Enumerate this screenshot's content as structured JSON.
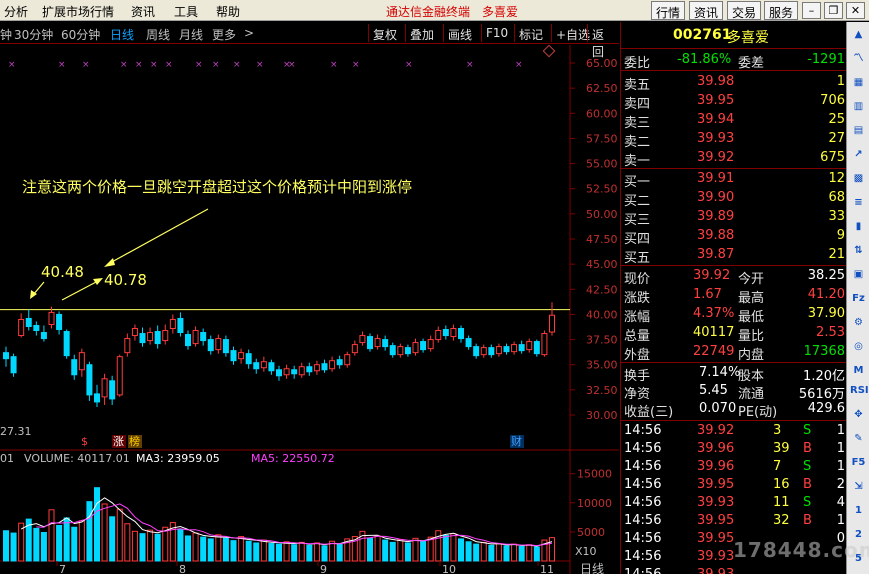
{
  "menu": {
    "items": [
      "分析",
      "扩展市场行情",
      "资讯",
      "工具",
      "帮助"
    ],
    "brand": "通达信金融终端",
    "stock_name_top": "多喜爱",
    "buttons": [
      "行情",
      "资讯",
      "交易",
      "服务"
    ]
  },
  "toolbar": {
    "periods": [
      "钟",
      "30分钟",
      "60分钟",
      "日线",
      "周线",
      "月线",
      "更多",
      ">"
    ],
    "active_period": "日线",
    "buttons": [
      "复权",
      "叠加",
      "画线",
      "F10",
      "标记",
      "+自选",
      "返回"
    ]
  },
  "chart": {
    "price_axis": [
      "65.00",
      "62.50",
      "60.00",
      "57.50",
      "55.00",
      "52.50",
      "50.00",
      "47.50",
      "45.00",
      "42.50",
      "40.00",
      "37.50",
      "35.00",
      "32.50",
      "30.00"
    ],
    "volume_axis": [
      "15000",
      "10000",
      "5000"
    ],
    "volume_unit": "X10",
    "annotation": "注意这两个价格一旦跳空开盘超过这个价格预计中阳到涨停",
    "label_a": "40.48",
    "label_b": "40.78",
    "low_label": "27.31",
    "markers": [
      "$",
      "涨",
      "榜",
      "财"
    ],
    "indicator": {
      "prefix": "01",
      "volume": "VOLUME: 40117.01",
      "ma3": "MA3: 23959.05",
      "ma5": "MA5: 22550.72"
    },
    "x_ticks": [
      "7",
      "8",
      "9",
      "10",
      "11"
    ],
    "period_label": "日线"
  },
  "chart_data": {
    "type": "candlestick",
    "ylim": [
      30,
      65
    ],
    "resistance": 40.48,
    "candles": [
      {
        "o": 36.2,
        "c": 35.6,
        "h": 36.8,
        "l": 34.8
      },
      {
        "o": 35.8,
        "c": 34.2,
        "h": 36.1,
        "l": 33.8
      },
      {
        "o": 37.9,
        "c": 39.5,
        "h": 40.1,
        "l": 37.7
      },
      {
        "o": 39.6,
        "c": 38.8,
        "h": 40.48,
        "l": 38.4
      },
      {
        "o": 38.9,
        "c": 38.4,
        "h": 39.3,
        "l": 37.9
      },
      {
        "o": 38.2,
        "c": 37.6,
        "h": 38.9,
        "l": 37.3
      },
      {
        "o": 39.0,
        "c": 40.2,
        "h": 40.78,
        "l": 38.6
      },
      {
        "o": 40.0,
        "c": 38.5,
        "h": 40.3,
        "l": 38.0
      },
      {
        "o": 38.3,
        "c": 35.9,
        "h": 38.5,
        "l": 35.6
      },
      {
        "o": 35.5,
        "c": 34.0,
        "h": 36.0,
        "l": 33.5
      },
      {
        "o": 34.5,
        "c": 36.2,
        "h": 36.6,
        "l": 33.8
      },
      {
        "o": 35.0,
        "c": 32.0,
        "h": 35.3,
        "l": 31.4
      },
      {
        "o": 32.1,
        "c": 31.3,
        "h": 33.0,
        "l": 30.8
      },
      {
        "o": 31.8,
        "c": 33.6,
        "h": 34.1,
        "l": 31.0
      },
      {
        "o": 33.4,
        "c": 31.6,
        "h": 33.9,
        "l": 31.0
      },
      {
        "o": 32.0,
        "c": 35.8,
        "h": 36.0,
        "l": 31.8
      },
      {
        "o": 36.2,
        "c": 37.6,
        "h": 38.1,
        "l": 35.8
      },
      {
        "o": 37.9,
        "c": 38.6,
        "h": 39.0,
        "l": 37.4
      },
      {
        "o": 38.1,
        "c": 37.2,
        "h": 38.7,
        "l": 36.8
      },
      {
        "o": 37.4,
        "c": 38.2,
        "h": 38.7,
        "l": 37.0
      },
      {
        "o": 38.3,
        "c": 37.1,
        "h": 38.9,
        "l": 36.6
      },
      {
        "o": 37.4,
        "c": 38.4,
        "h": 39.0,
        "l": 37.0
      },
      {
        "o": 38.6,
        "c": 39.5,
        "h": 40.0,
        "l": 38.1
      },
      {
        "o": 39.6,
        "c": 38.2,
        "h": 40.2,
        "l": 37.8
      },
      {
        "o": 38.0,
        "c": 36.9,
        "h": 38.4,
        "l": 36.5
      },
      {
        "o": 37.1,
        "c": 38.4,
        "h": 38.8,
        "l": 36.8
      },
      {
        "o": 38.2,
        "c": 37.4,
        "h": 38.6,
        "l": 36.9
      },
      {
        "o": 37.5,
        "c": 36.4,
        "h": 37.9,
        "l": 36.0
      },
      {
        "o": 36.5,
        "c": 37.6,
        "h": 38.0,
        "l": 36.1
      },
      {
        "o": 37.5,
        "c": 36.2,
        "h": 37.9,
        "l": 35.8
      },
      {
        "o": 36.4,
        "c": 35.4,
        "h": 36.8,
        "l": 35.0
      },
      {
        "o": 35.6,
        "c": 36.2,
        "h": 36.6,
        "l": 35.1
      },
      {
        "o": 36.1,
        "c": 35.1,
        "h": 36.5,
        "l": 34.6
      },
      {
        "o": 35.2,
        "c": 34.6,
        "h": 35.6,
        "l": 34.1
      },
      {
        "o": 34.7,
        "c": 35.3,
        "h": 35.8,
        "l": 34.3
      },
      {
        "o": 35.2,
        "c": 34.4,
        "h": 35.5,
        "l": 34.0
      },
      {
        "o": 34.5,
        "c": 33.9,
        "h": 34.9,
        "l": 33.4
      },
      {
        "o": 34.0,
        "c": 34.6,
        "h": 35.0,
        "l": 33.6
      },
      {
        "o": 34.5,
        "c": 34.1,
        "h": 34.9,
        "l": 33.6
      },
      {
        "o": 34.0,
        "c": 34.8,
        "h": 35.2,
        "l": 33.7
      },
      {
        "o": 34.8,
        "c": 34.3,
        "h": 35.2,
        "l": 33.9
      },
      {
        "o": 34.4,
        "c": 35.0,
        "h": 35.4,
        "l": 34.0
      },
      {
        "o": 35.1,
        "c": 34.5,
        "h": 35.5,
        "l": 34.2
      },
      {
        "o": 34.6,
        "c": 35.4,
        "h": 35.8,
        "l": 34.3
      },
      {
        "o": 35.5,
        "c": 35.0,
        "h": 35.9,
        "l": 34.6
      },
      {
        "o": 35.0,
        "c": 36.0,
        "h": 36.3,
        "l": 34.7
      },
      {
        "o": 36.2,
        "c": 37.0,
        "h": 37.4,
        "l": 35.9
      },
      {
        "o": 37.2,
        "c": 37.9,
        "h": 38.3,
        "l": 36.9
      },
      {
        "o": 37.8,
        "c": 36.6,
        "h": 38.1,
        "l": 36.3
      },
      {
        "o": 36.8,
        "c": 37.6,
        "h": 38.0,
        "l": 36.5
      },
      {
        "o": 37.5,
        "c": 36.8,
        "h": 37.9,
        "l": 36.4
      },
      {
        "o": 36.9,
        "c": 36.0,
        "h": 37.2,
        "l": 35.7
      },
      {
        "o": 36.0,
        "c": 36.8,
        "h": 37.1,
        "l": 35.7
      },
      {
        "o": 36.7,
        "c": 36.1,
        "h": 37.0,
        "l": 35.8
      },
      {
        "o": 36.2,
        "c": 37.2,
        "h": 37.6,
        "l": 35.9
      },
      {
        "o": 37.3,
        "c": 36.5,
        "h": 37.6,
        "l": 36.2
      },
      {
        "o": 36.6,
        "c": 37.5,
        "h": 37.9,
        "l": 36.3
      },
      {
        "o": 37.5,
        "c": 38.4,
        "h": 38.8,
        "l": 37.2
      },
      {
        "o": 38.5,
        "c": 37.9,
        "h": 38.9,
        "l": 37.5
      },
      {
        "o": 37.8,
        "c": 38.6,
        "h": 39.0,
        "l": 37.4
      },
      {
        "o": 38.6,
        "c": 37.6,
        "h": 38.9,
        "l": 37.2
      },
      {
        "o": 37.6,
        "c": 36.8,
        "h": 37.9,
        "l": 36.5
      },
      {
        "o": 36.8,
        "c": 35.9,
        "h": 37.1,
        "l": 35.6
      },
      {
        "o": 36.0,
        "c": 36.7,
        "h": 37.0,
        "l": 35.7
      },
      {
        "o": 36.7,
        "c": 36.0,
        "h": 37.0,
        "l": 35.7
      },
      {
        "o": 36.1,
        "c": 36.8,
        "h": 37.1,
        "l": 35.8
      },
      {
        "o": 36.8,
        "c": 36.3,
        "h": 37.1,
        "l": 36.0
      },
      {
        "o": 36.3,
        "c": 37.0,
        "h": 37.3,
        "l": 36.0
      },
      {
        "o": 37.0,
        "c": 36.4,
        "h": 37.4,
        "l": 36.1
      },
      {
        "o": 36.5,
        "c": 37.3,
        "h": 37.6,
        "l": 36.2
      },
      {
        "o": 37.3,
        "c": 36.1,
        "h": 37.5,
        "l": 35.8
      },
      {
        "o": 36.0,
        "c": 38.1,
        "h": 38.4,
        "l": 35.8
      },
      {
        "o": 38.25,
        "c": 39.92,
        "h": 41.2,
        "l": 37.9
      }
    ],
    "volume": [
      5200,
      4800,
      6500,
      7200,
      5600,
      4900,
      8800,
      6100,
      7400,
      5800,
      6900,
      10200,
      12600,
      9800,
      7600,
      8900,
      6400,
      5100,
      4700,
      5300,
      4600,
      5800,
      6600,
      5400,
      4300,
      4800,
      4100,
      3800,
      4500,
      3900,
      3500,
      4200,
      3400,
      3100,
      3600,
      3000,
      2900,
      3300,
      2800,
      3200,
      2700,
      3100,
      2600,
      3400,
      2900,
      3800,
      4200,
      5100,
      3900,
      4300,
      3600,
      3200,
      3700,
      3100,
      3900,
      3400,
      4100,
      5200,
      4400,
      4700,
      3800,
      3300,
      2900,
      3200,
      2700,
      3000,
      2600,
      2900,
      2500,
      2800,
      2400,
      3600,
      4012
    ]
  },
  "quote": {
    "code": "002761",
    "name": "多喜爱",
    "weibi_label": "委比",
    "weibi_value": "-81.86%",
    "weicha_label": "委差",
    "weicha_value": "-1291",
    "asks": [
      {
        "label": "卖五",
        "price": "39.98",
        "vol": "1"
      },
      {
        "label": "卖四",
        "price": "39.95",
        "vol": "706"
      },
      {
        "label": "卖三",
        "price": "39.94",
        "vol": "25"
      },
      {
        "label": "卖二",
        "price": "39.93",
        "vol": "27"
      },
      {
        "label": "卖一",
        "price": "39.92",
        "vol": "675"
      }
    ],
    "bids": [
      {
        "label": "买一",
        "price": "39.91",
        "vol": "12"
      },
      {
        "label": "买二",
        "price": "39.90",
        "vol": "68"
      },
      {
        "label": "买三",
        "price": "39.89",
        "vol": "33"
      },
      {
        "label": "买四",
        "price": "39.88",
        "vol": "9"
      },
      {
        "label": "买五",
        "price": "39.87",
        "vol": "21"
      }
    ],
    "stats": [
      {
        "l1": "现价",
        "v1": "39.92",
        "c1": "red",
        "l2": "今开",
        "v2": "38.25",
        "c2": "wht"
      },
      {
        "l1": "涨跌",
        "v1": "1.67",
        "c1": "red",
        "l2": "最高",
        "v2": "41.20",
        "c2": "red"
      },
      {
        "l1": "涨幅",
        "v1": "4.37%",
        "c1": "red",
        "l2": "最低",
        "v2": "37.90",
        "c2": "yel"
      },
      {
        "l1": "总量",
        "v1": "40117",
        "c1": "yel",
        "l2": "量比",
        "v2": "2.53",
        "c2": "red"
      },
      {
        "l1": "外盘",
        "v1": "22749",
        "c1": "red",
        "l2": "内盘",
        "v2": "17368",
        "c2": "grn"
      }
    ],
    "fund": [
      {
        "l1": "换手",
        "v1": "7.14%",
        "l2": "股本",
        "v2": "1.20亿"
      },
      {
        "l1": "净资",
        "v1": "5.45",
        "l2": "流通",
        "v2": "5616万"
      },
      {
        "l1": "收益(三)",
        "v1": "0.070",
        "l2": "PE(动)",
        "v2": "429.6"
      }
    ],
    "ticks": [
      {
        "t": "14:56",
        "p": "39.92",
        "pc": "red",
        "v": "3",
        "s": "S"
      },
      {
        "t": "14:56",
        "p": "39.96",
        "pc": "red",
        "v": "39",
        "s": "B"
      },
      {
        "t": "14:56",
        "p": "39.96",
        "pc": "red",
        "v": "7",
        "s": "S"
      },
      {
        "t": "14:56",
        "p": "39.95",
        "pc": "red",
        "v": "16",
        "s": "B"
      },
      {
        "t": "14:56",
        "p": "39.93",
        "pc": "red",
        "v": "11",
        "s": "S"
      },
      {
        "t": "14:56",
        "p": "39.95",
        "pc": "red",
        "v": "32",
        "s": "B"
      },
      {
        "t": "14:56",
        "p": "39.95",
        "pc": "red",
        "v": "",
        "s": ""
      },
      {
        "t": "14:56",
        "p": "39.93",
        "pc": "red",
        "v": "",
        "s": ""
      },
      {
        "t": "14:56",
        "p": "39.93",
        "pc": "red",
        "v": "",
        "s": ""
      }
    ],
    "tick_extra": [
      "1",
      "1",
      "1",
      "2",
      "4",
      "1",
      "0",
      "",
      ""
    ]
  },
  "watermark": "178448.com",
  "colors": {
    "up": "#ff3b3b",
    "down": "#00d8ff",
    "resistance": "#ffff60",
    "annotation": "#ffff60",
    "ma3": "#ffffff",
    "ma5": "#ff40ff",
    "axis": "#800000"
  }
}
